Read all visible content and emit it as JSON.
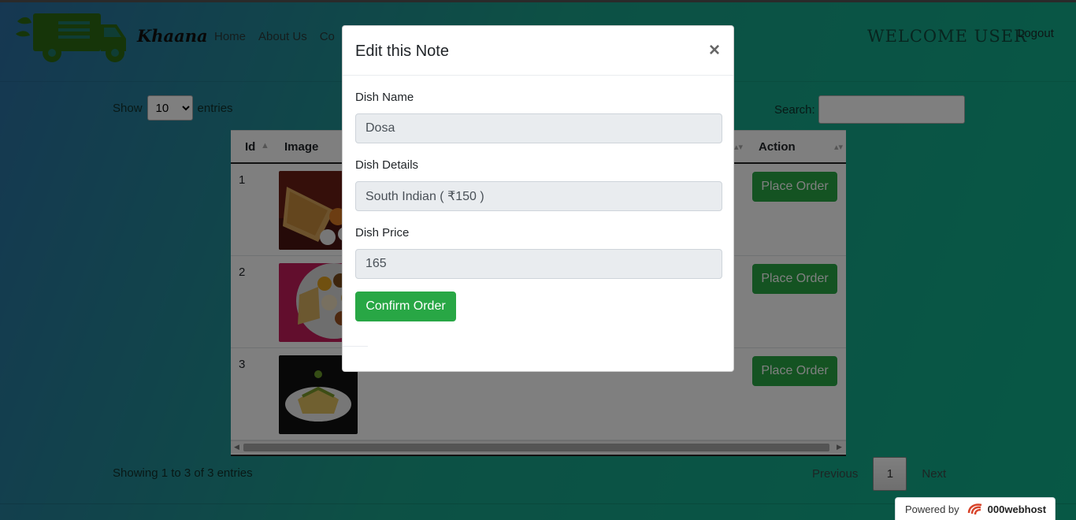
{
  "navbar": {
    "brand": "Khaana",
    "links": [
      "Home",
      "About Us",
      "Co"
    ],
    "welcome": "WELCOME USER",
    "logout": "Logout"
  },
  "table_controls": {
    "show_label": "Show",
    "entries_value": "10",
    "entries_label": "entries",
    "search_label": "Search:"
  },
  "table": {
    "headers": {
      "id": "Id",
      "image": "Image",
      "action": "Action"
    },
    "rows": [
      {
        "id": "1",
        "action_label": "Place Order"
      },
      {
        "id": "2",
        "action_label": "Place Order"
      },
      {
        "id": "3",
        "action_label": "Place Order"
      }
    ]
  },
  "footer": {
    "info": "Showing 1 to 3 of 3 entries",
    "previous": "Previous",
    "page": "1",
    "next": "Next",
    "powered_by": "Powered by",
    "host_brand": "000webhost"
  },
  "modal": {
    "title": "Edit this Note",
    "close_symbol": "×",
    "dish_name_label": "Dish Name",
    "dish_name_value": "Dosa",
    "dish_details_label": "Dish Details",
    "dish_details_value": "South Indian ( ₹150 )",
    "dish_price_label": "Dish Price",
    "dish_price_value": "165",
    "confirm_label": "Confirm Order"
  },
  "colors": {
    "accent_green": "#28a745",
    "bg_gradient_start": "#2c6fa4",
    "bg_gradient_end": "#0fb08a"
  }
}
